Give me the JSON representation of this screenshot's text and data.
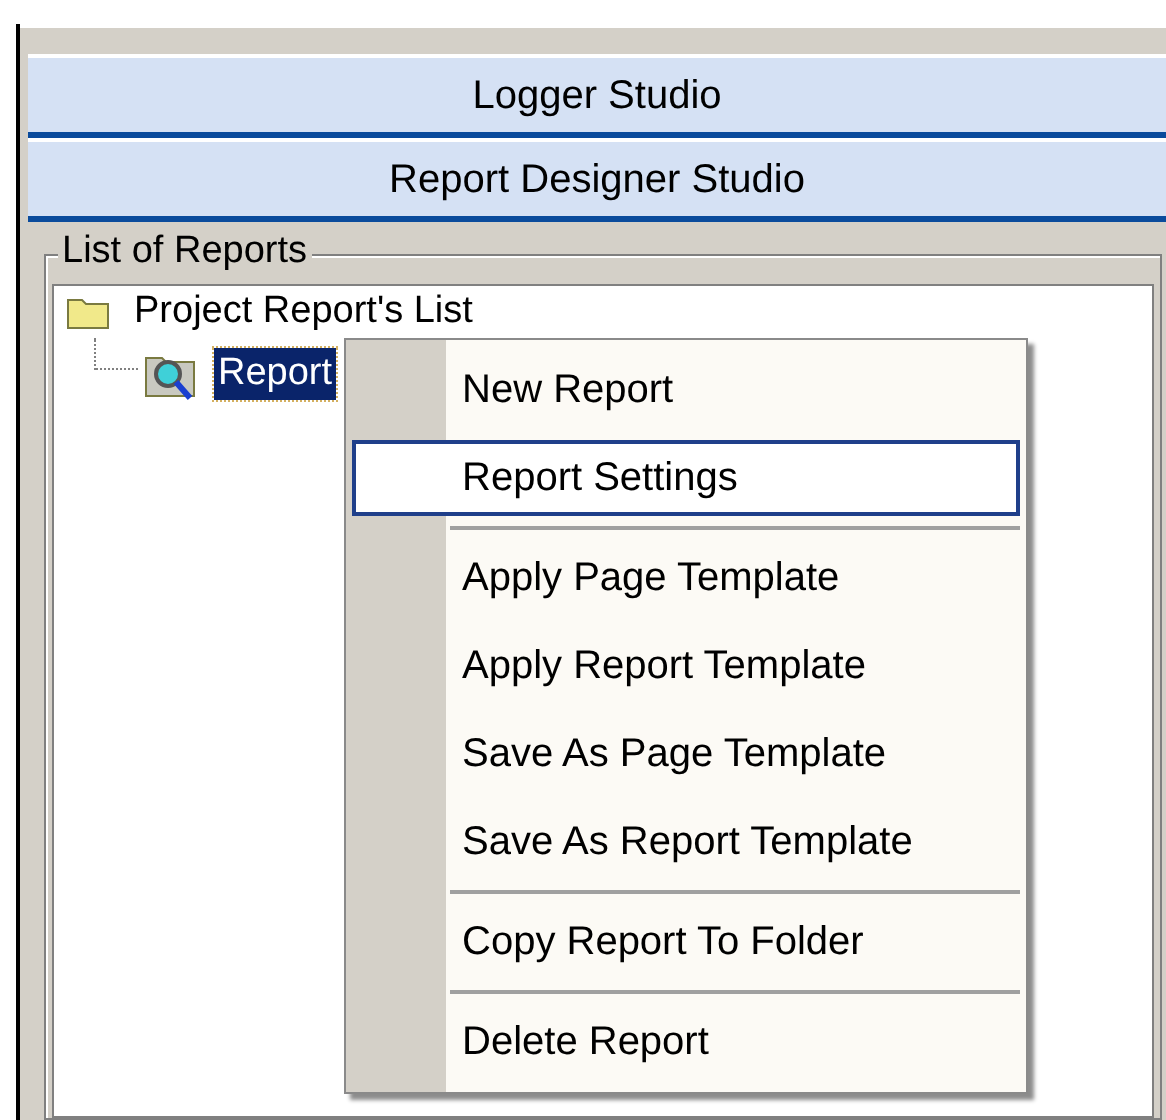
{
  "bars": [
    {
      "label": "Logger Studio"
    },
    {
      "label": "Report Designer Studio"
    }
  ],
  "group": {
    "title": "List of Reports"
  },
  "tree": [
    {
      "label": "Project Report's List",
      "kind": "folder",
      "selected": false,
      "children": [
        {
          "label": "Report",
          "kind": "report",
          "selected": true
        }
      ]
    }
  ],
  "context_menu": [
    {
      "kind": "item",
      "label": "New Report",
      "selected": false
    },
    {
      "kind": "item",
      "label": "Report Settings",
      "selected": true
    },
    {
      "kind": "separator"
    },
    {
      "kind": "item",
      "label": "Apply Page Template",
      "selected": false
    },
    {
      "kind": "item",
      "label": "Apply Report Template",
      "selected": false
    },
    {
      "kind": "item",
      "label": "Save As Page Template",
      "selected": false
    },
    {
      "kind": "item",
      "label": "Save As Report Template",
      "selected": false
    },
    {
      "kind": "separator"
    },
    {
      "kind": "item",
      "label": "Copy Report To Folder",
      "selected": false
    },
    {
      "kind": "separator"
    },
    {
      "kind": "item",
      "label": "Delete Report",
      "selected": false
    }
  ]
}
